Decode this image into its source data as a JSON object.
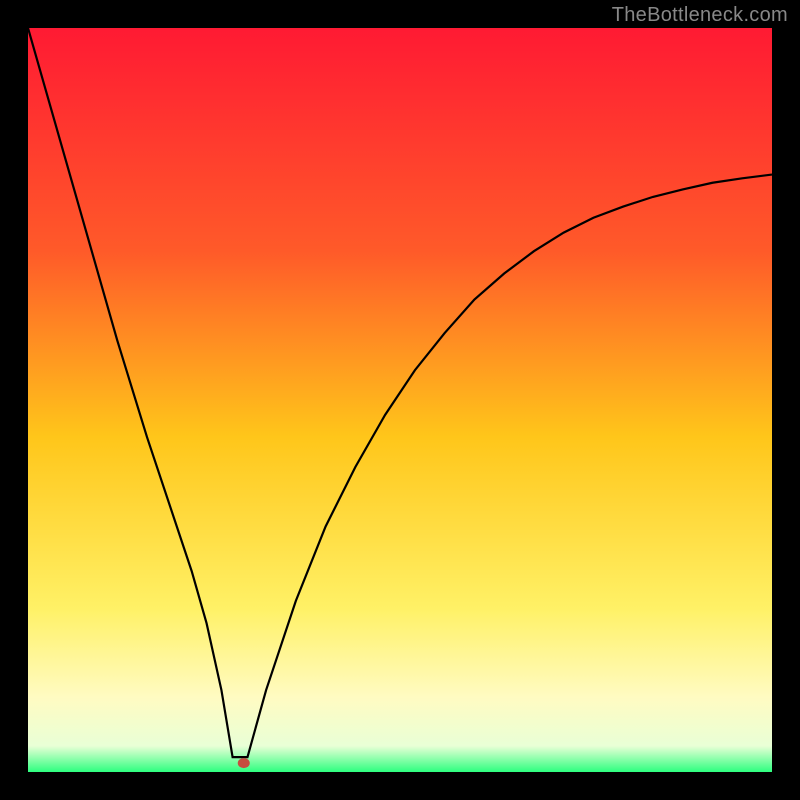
{
  "watermark": "TheBottleneck.com",
  "chart_data": {
    "type": "line",
    "title": "",
    "xlabel": "",
    "ylabel": "",
    "xlim": [
      0,
      100
    ],
    "ylim": [
      0,
      100
    ],
    "grid": false,
    "legend": false,
    "gradient_stops": [
      {
        "pos": 0.0,
        "color": "#ff1a33"
      },
      {
        "pos": 0.3,
        "color": "#ff5a29"
      },
      {
        "pos": 0.55,
        "color": "#ffc61a"
      },
      {
        "pos": 0.78,
        "color": "#fff166"
      },
      {
        "pos": 0.9,
        "color": "#fffbc2"
      },
      {
        "pos": 0.965,
        "color": "#e9ffd6"
      },
      {
        "pos": 1.0,
        "color": "#2dff7f"
      }
    ],
    "series": [
      {
        "name": "bottleneck-curve",
        "x": [
          0,
          4,
          8,
          12,
          16,
          20,
          22,
          24,
          26,
          27.5,
          29.5,
          32,
          36,
          40,
          44,
          48,
          52,
          56,
          60,
          64,
          68,
          72,
          76,
          80,
          84,
          88,
          92,
          96,
          100
        ],
        "y": [
          100,
          86,
          72,
          58,
          45,
          33,
          27,
          20,
          11,
          2,
          2,
          11,
          23,
          33,
          41,
          48,
          54,
          59,
          63.5,
          67,
          70,
          72.5,
          74.5,
          76,
          77.3,
          78.3,
          79.2,
          79.8,
          80.3
        ]
      }
    ],
    "marker": {
      "x": 29,
      "y": 1.2,
      "rx": 6,
      "ry": 5,
      "color": "#c64d3f"
    }
  }
}
